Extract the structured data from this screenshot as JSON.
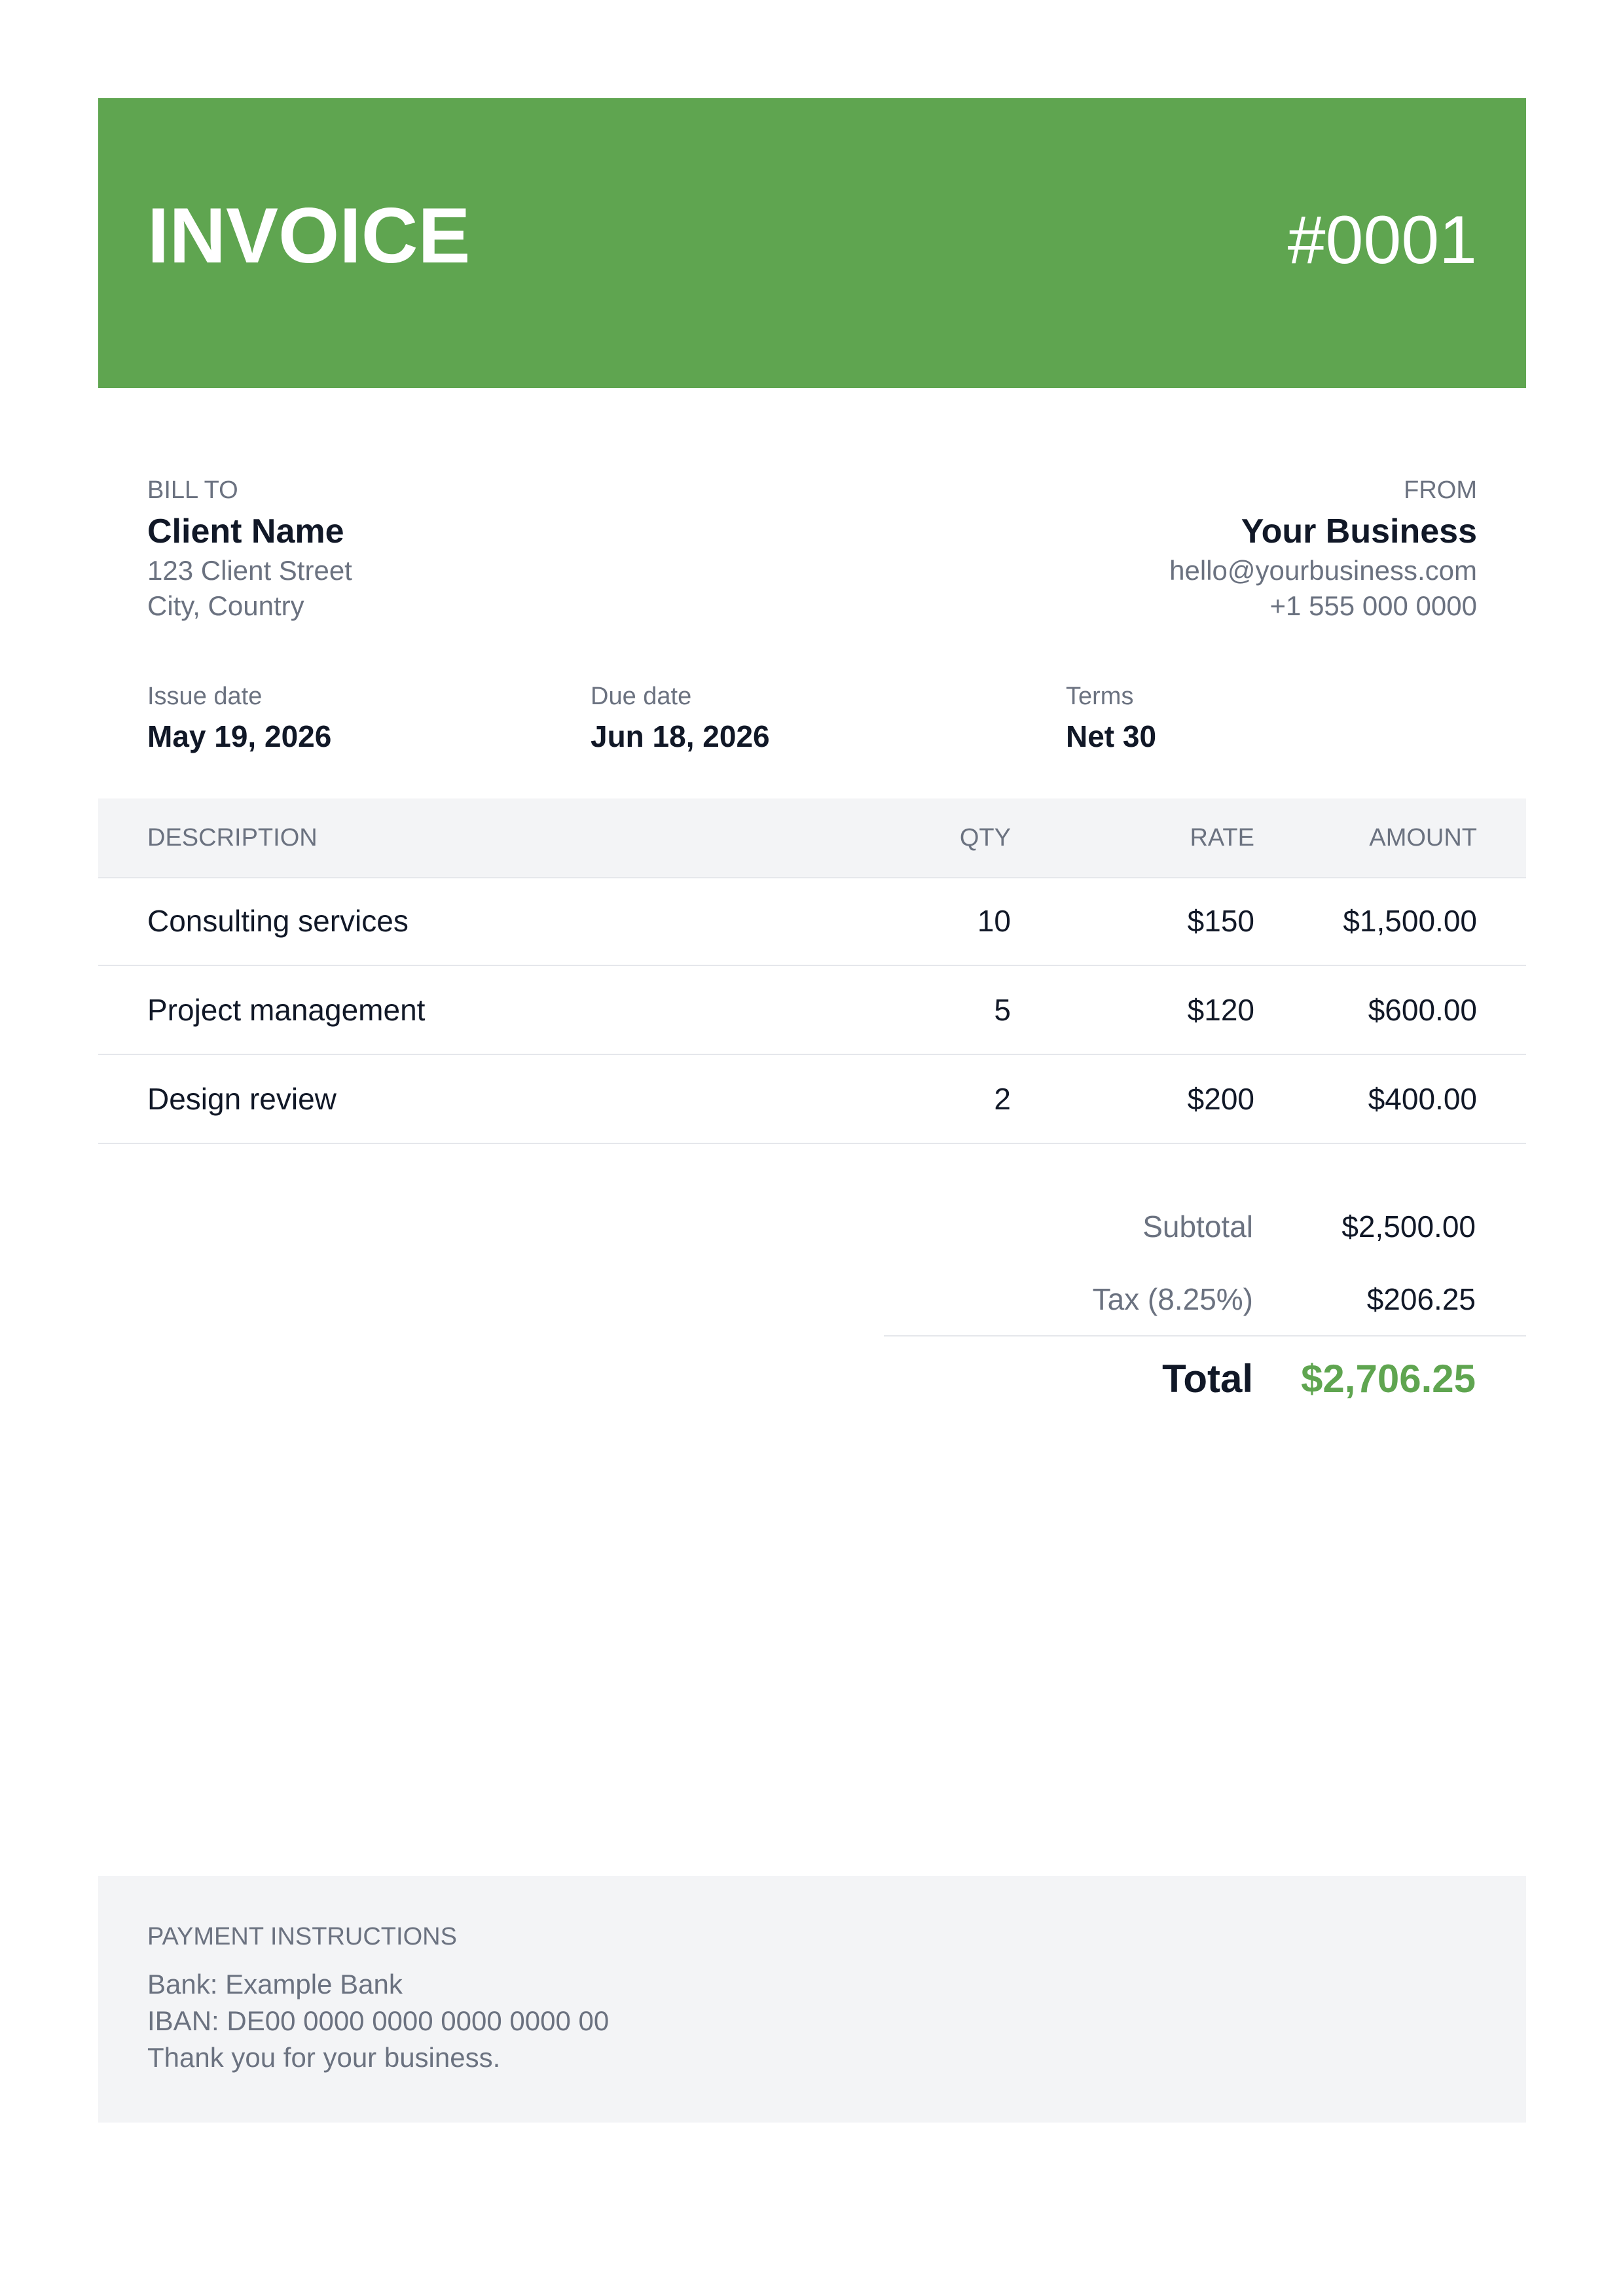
{
  "header": {
    "title": "INVOICE",
    "number": "#0001",
    "color": "#5fa550"
  },
  "bill_to": {
    "label": "BILL TO",
    "name": "Client Name",
    "address1": "123 Client Street",
    "address2": "City, Country"
  },
  "from": {
    "label": "FROM",
    "name": "Your Business",
    "email": "hello@yourbusiness.com",
    "phone": "+1 555 000 0000"
  },
  "meta": {
    "issue_label": "Issue date",
    "issue_value": "May 19, 2026",
    "due_label": "Due date",
    "due_value": "Jun 18, 2026",
    "terms_label": "Terms",
    "terms_value": "Net 30"
  },
  "table": {
    "headers": [
      "DESCRIPTION",
      "QTY",
      "RATE",
      "AMOUNT"
    ],
    "rows": [
      {
        "description": "Consulting services",
        "qty": "10",
        "rate": "$150",
        "amount": "$1,500.00"
      },
      {
        "description": "Project management",
        "qty": "5",
        "rate": "$120",
        "amount": "$600.00"
      },
      {
        "description": "Design review",
        "qty": "2",
        "rate": "$200",
        "amount": "$400.00"
      }
    ]
  },
  "totals": {
    "subtotal_label": "Subtotal",
    "subtotal_value": "$2,500.00",
    "tax_label": "Tax (8.25%)",
    "tax_value": "$206.25",
    "total_label": "Total",
    "total_value": "$2,706.25"
  },
  "payment": {
    "label": "PAYMENT INSTRUCTIONS",
    "bank": "Bank: Example Bank",
    "iban": "IBAN: DE00 0000 0000 0000 0000 00",
    "note": "Thank you for your business."
  }
}
